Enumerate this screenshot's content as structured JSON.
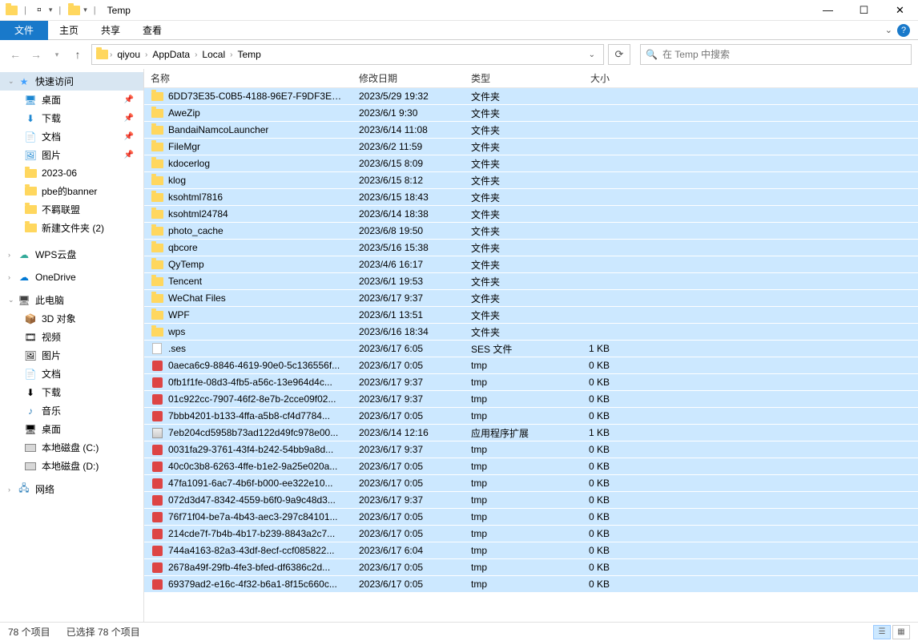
{
  "window": {
    "title": "Temp"
  },
  "ribbon": {
    "file": "文件",
    "tabs": [
      "主页",
      "共享",
      "查看"
    ]
  },
  "breadcrumb": {
    "items": [
      "qiyou",
      "AppData",
      "Local",
      "Temp"
    ]
  },
  "search": {
    "placeholder": "在 Temp 中搜索"
  },
  "sidebar": {
    "quick": "快速访问",
    "desktop": "桌面",
    "downloads": "下载",
    "documents": "文档",
    "pictures": "图片",
    "folder_2023_06": "2023-06",
    "pbe_banner": "pbe的banner",
    "buji": "不羁联盟",
    "newfolder2": "新建文件夹 (2)",
    "wps": "WPS云盘",
    "onedrive": "OneDrive",
    "thispc": "此电脑",
    "objects3d": "3D 对象",
    "videos": "视频",
    "pictures2": "图片",
    "documents2": "文档",
    "downloads2": "下载",
    "music": "音乐",
    "desktop2": "桌面",
    "driveC": "本地磁盘 (C:)",
    "driveD": "本地磁盘 (D:)",
    "network": "网络"
  },
  "columns": {
    "name": "名称",
    "date": "修改日期",
    "type": "类型",
    "size": "大小"
  },
  "type_labels": {
    "folder": "文件夹",
    "ses": "SES 文件",
    "tmp": "tmp",
    "appext": "应用程序扩展"
  },
  "files": [
    {
      "icon": "folder",
      "name": "6DD73E35-C0B5-4188-96E7-F9DF3EE...",
      "date": "2023/5/29 19:32",
      "type": "folder",
      "size": ""
    },
    {
      "icon": "folder",
      "name": "AweZip",
      "date": "2023/6/1 9:30",
      "type": "folder",
      "size": ""
    },
    {
      "icon": "folder",
      "name": "BandaiNamcoLauncher",
      "date": "2023/6/14 11:08",
      "type": "folder",
      "size": ""
    },
    {
      "icon": "folder",
      "name": "FileMgr",
      "date": "2023/6/2 11:59",
      "type": "folder",
      "size": ""
    },
    {
      "icon": "folder",
      "name": "kdocerlog",
      "date": "2023/6/15 8:09",
      "type": "folder",
      "size": ""
    },
    {
      "icon": "folder",
      "name": "klog",
      "date": "2023/6/15 8:12",
      "type": "folder",
      "size": ""
    },
    {
      "icon": "folder",
      "name": "ksohtml7816",
      "date": "2023/6/15 18:43",
      "type": "folder",
      "size": ""
    },
    {
      "icon": "folder",
      "name": "ksohtml24784",
      "date": "2023/6/14 18:38",
      "type": "folder",
      "size": ""
    },
    {
      "icon": "folder",
      "name": "photo_cache",
      "date": "2023/6/8 19:50",
      "type": "folder",
      "size": ""
    },
    {
      "icon": "folder",
      "name": "qbcore",
      "date": "2023/5/16 15:38",
      "type": "folder",
      "size": ""
    },
    {
      "icon": "folder",
      "name": "QyTemp",
      "date": "2023/4/6 16:17",
      "type": "folder",
      "size": ""
    },
    {
      "icon": "folder",
      "name": "Tencent",
      "date": "2023/6/1 19:53",
      "type": "folder",
      "size": ""
    },
    {
      "icon": "folder",
      "name": "WeChat Files",
      "date": "2023/6/17 9:37",
      "type": "folder",
      "size": ""
    },
    {
      "icon": "folder",
      "name": "WPF",
      "date": "2023/6/1 13:51",
      "type": "folder",
      "size": ""
    },
    {
      "icon": "folder",
      "name": "wps",
      "date": "2023/6/16 18:34",
      "type": "folder",
      "size": ""
    },
    {
      "icon": "doc",
      "name": ".ses",
      "date": "2023/6/17 6:05",
      "type": "ses",
      "size": "1 KB"
    },
    {
      "icon": "tmp",
      "name": "0aeca6c9-8846-4619-90e0-5c136556f...",
      "date": "2023/6/17 0:05",
      "type": "tmp",
      "size": "0 KB"
    },
    {
      "icon": "tmp",
      "name": "0fb1f1fe-08d3-4fb5-a56c-13e964d4c...",
      "date": "2023/6/17 9:37",
      "type": "tmp",
      "size": "0 KB"
    },
    {
      "icon": "tmp",
      "name": "01c922cc-7907-46f2-8e7b-2cce09f02...",
      "date": "2023/6/17 9:37",
      "type": "tmp",
      "size": "0 KB"
    },
    {
      "icon": "tmp",
      "name": "7bbb4201-b133-4ffa-a5b8-cf4d7784...",
      "date": "2023/6/17 0:05",
      "type": "tmp",
      "size": "0 KB"
    },
    {
      "icon": "dll",
      "name": "7eb204cd5958b73ad122d49fc978e00...",
      "date": "2023/6/14 12:16",
      "type": "appext",
      "size": "1 KB"
    },
    {
      "icon": "tmp",
      "name": "0031fa29-3761-43f4-b242-54bb9a8d...",
      "date": "2023/6/17 9:37",
      "type": "tmp",
      "size": "0 KB"
    },
    {
      "icon": "tmp",
      "name": "40c0c3b8-6263-4ffe-b1e2-9a25e020a...",
      "date": "2023/6/17 0:05",
      "type": "tmp",
      "size": "0 KB"
    },
    {
      "icon": "tmp",
      "name": "47fa1091-6ac7-4b6f-b000-ee322e10...",
      "date": "2023/6/17 0:05",
      "type": "tmp",
      "size": "0 KB"
    },
    {
      "icon": "tmp",
      "name": "072d3d47-8342-4559-b6f0-9a9c48d3...",
      "date": "2023/6/17 9:37",
      "type": "tmp",
      "size": "0 KB"
    },
    {
      "icon": "tmp",
      "name": "76f71f04-be7a-4b43-aec3-297c84101...",
      "date": "2023/6/17 0:05",
      "type": "tmp",
      "size": "0 KB"
    },
    {
      "icon": "tmp",
      "name": "214cde7f-7b4b-4b17-b239-8843a2c7...",
      "date": "2023/6/17 0:05",
      "type": "tmp",
      "size": "0 KB"
    },
    {
      "icon": "tmp",
      "name": "744a4163-82a3-43df-8ecf-ccf085822...",
      "date": "2023/6/17 6:04",
      "type": "tmp",
      "size": "0 KB"
    },
    {
      "icon": "tmp",
      "name": "2678a49f-29fb-4fe3-bfed-df6386c2d...",
      "date": "2023/6/17 0:05",
      "type": "tmp",
      "size": "0 KB"
    },
    {
      "icon": "tmp",
      "name": "69379ad2-e16c-4f32-b6a1-8f15c660c...",
      "date": "2023/6/17 0:05",
      "type": "tmp",
      "size": "0 KB"
    }
  ],
  "status": {
    "total": "78 个项目",
    "selected": "已选择 78 个项目"
  }
}
